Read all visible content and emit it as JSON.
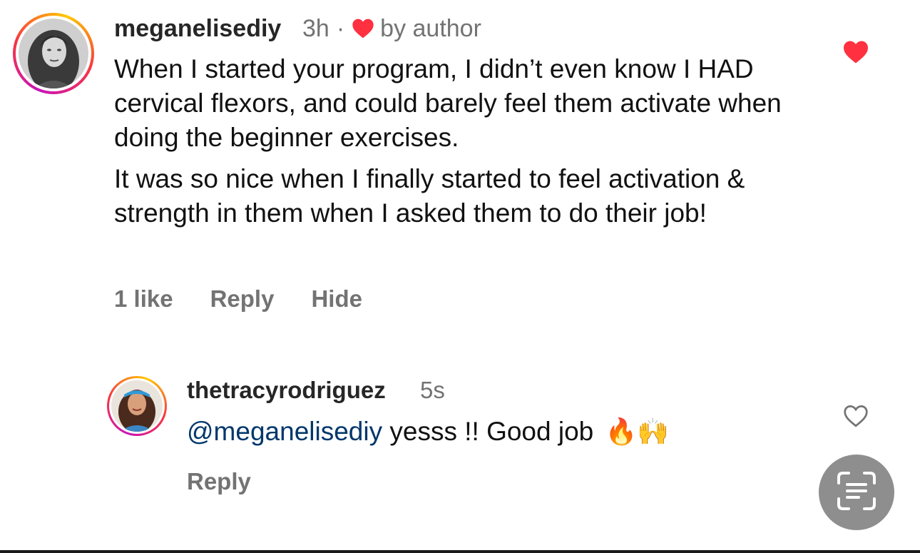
{
  "comment": {
    "username": "meganelisediy",
    "time": "3h",
    "separator": "·",
    "liked_by_author_label": "by author",
    "paragraphs": [
      "When I started your program, I didn’t even know I HAD cervical flexors, and could barely feel them activate when doing the beginner exercises.",
      "It was so nice when I finally started to feel activation & strength in them when I asked them to do their job!"
    ],
    "likes_label": "1 like",
    "reply_label": "Reply",
    "hide_label": "Hide",
    "liked": true
  },
  "reply": {
    "username": "thetracyrodriguez",
    "time": "5s",
    "mention": "@meganelisediy",
    "text": " yesss !! Good job",
    "emojis": "🔥🙌",
    "reply_label": "Reply",
    "liked": false
  },
  "colors": {
    "like_red": "#ff3040",
    "mention_blue": "#00376b",
    "meta_gray": "#737373",
    "scan_button_gray": "#8e8e8e"
  },
  "icons": {
    "comment_like": "heart-filled-icon",
    "author_badge": "heart-filled-icon",
    "reply_like": "heart-outline-icon",
    "floating_button": "text-scan-icon"
  }
}
